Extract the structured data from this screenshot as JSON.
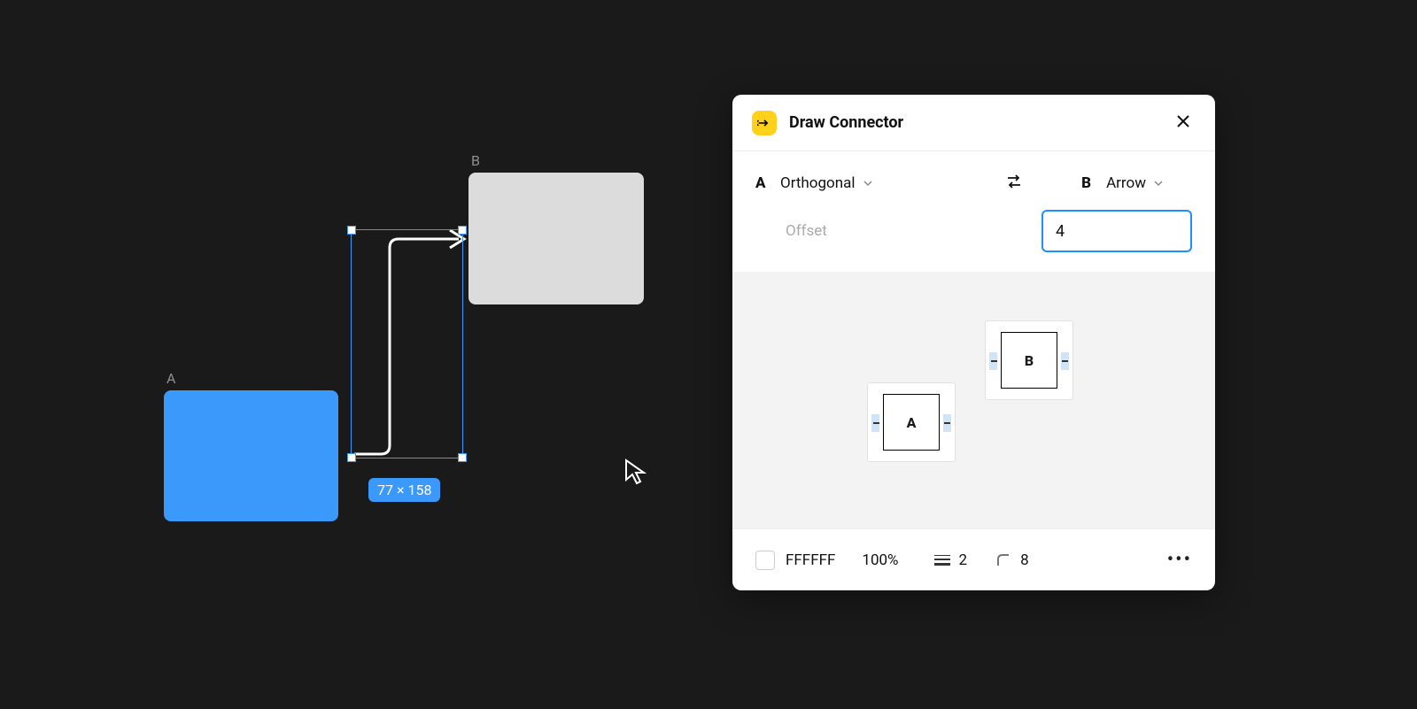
{
  "canvas": {
    "nodeA": {
      "label": "A"
    },
    "nodeB": {
      "label": "B"
    },
    "selectionSize": "77 × 158"
  },
  "panel": {
    "title": "Draw Connector",
    "endA": {
      "label": "A",
      "type": "Orthogonal"
    },
    "endB": {
      "label": "B",
      "type": "Arrow"
    },
    "offset": {
      "label": "Offset",
      "value": "4"
    },
    "preview": {
      "a": "A",
      "b": "B"
    },
    "stroke": {
      "colorHex": "FFFFFF",
      "opacity": "100%",
      "width": "2",
      "cornerRadius": "8"
    }
  }
}
